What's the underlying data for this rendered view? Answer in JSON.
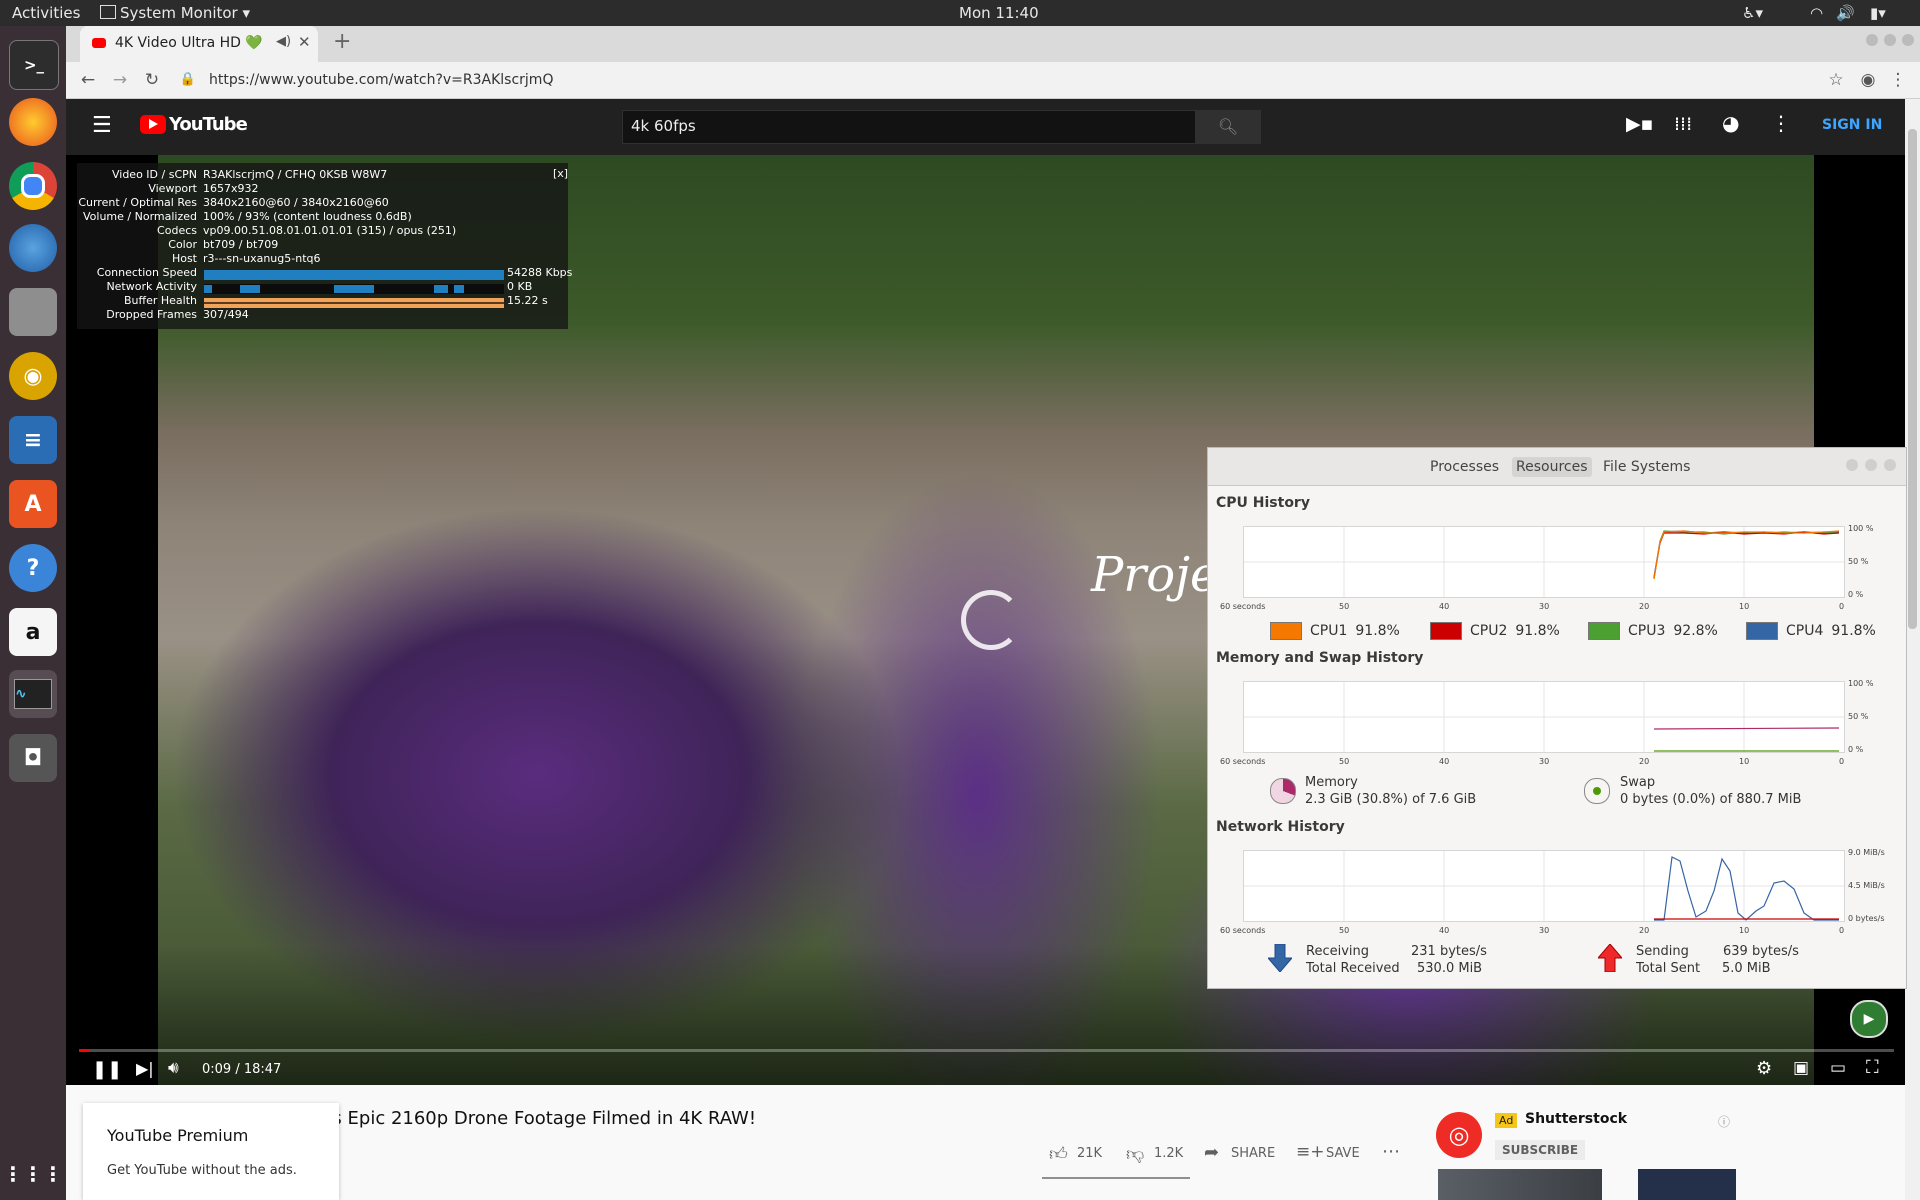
{
  "topbar": {
    "activities": "Activities",
    "app_menu": "System Monitor",
    "clock": "Mon 11:40"
  },
  "dock": {
    "items": [
      "terminal-icon",
      "firefox-icon",
      "chrome-icon",
      "thunderbird-icon",
      "files-icon",
      "rhythmbox-icon",
      "writer-icon",
      "software-icon",
      "help-icon",
      "amazon-icon",
      "system-monitor-icon",
      "screenshot-icon",
      "show-apps-icon"
    ]
  },
  "browser": {
    "tab_title": "4K Video Ultra HD 💚",
    "new_tab": "+",
    "url": "https://www.youtube.com/watch?v=R3AKlscrjmQ"
  },
  "youtube": {
    "logo_text": "YouTube",
    "search_value": "4k 60fps",
    "sign_in": "SIGN IN",
    "video_overlay_text": "Projec",
    "time": "0:09 / 18:47",
    "title": "ps Epic 2160p Drone Footage Filmed in 4K RAW!",
    "likes": "21K",
    "dislikes": "1.2K",
    "share": "SHARE",
    "save": "SAVE",
    "premium_title": "YouTube Premium",
    "premium_sub": "Get YouTube without the ads.",
    "ad_badge": "Ad",
    "ad_channel": "Shutterstock",
    "ad_subscribe": "SUBSCRIBE",
    "accent": "#ff0000",
    "signin_color": "#3ea6ff"
  },
  "stats": {
    "close": "[x]",
    "rows": [
      {
        "label": "Video ID / sCPN",
        "value": "R3AKlscrjmQ / CFHQ 0KSB W8W7"
      },
      {
        "label": "Viewport",
        "value": "1657x932"
      },
      {
        "label": "Current / Optimal Res",
        "value": "3840x2160@60 / 3840x2160@60"
      },
      {
        "label": "Volume / Normalized",
        "value": "100% / 93% (content loudness 0.6dB)"
      },
      {
        "label": "Codecs",
        "value": "vp09.00.51.08.01.01.01.01 (315) / opus (251)"
      },
      {
        "label": "Color",
        "value": "bt709 / bt709"
      },
      {
        "label": "Host",
        "value": "r3---sn-uxanug5-ntq6"
      },
      {
        "label": "Connection Speed",
        "value": "54288 Kbps"
      },
      {
        "label": "Network Activity",
        "value": "0 KB"
      },
      {
        "label": "Buffer Health",
        "value": "15.22 s"
      },
      {
        "label": "Dropped Frames",
        "value": "307/494"
      }
    ]
  },
  "sysmon": {
    "tabs": [
      "Processes",
      "Resources",
      "File Systems"
    ],
    "cpu_title": "CPU History",
    "mem_title": "Memory and Swap History",
    "net_title": "Network History",
    "x_ticks": [
      "60 seconds",
      "50",
      "40",
      "30",
      "20",
      "10",
      "0"
    ],
    "pct_ticks": [
      "100 %",
      "50 %",
      "0 %"
    ],
    "net_ticks": [
      "9.0 MiB/s",
      "4.5 MiB/s",
      "0 bytes/s"
    ],
    "cpus": [
      {
        "label": "CPU1",
        "value": "91.8%",
        "color": "#f57900"
      },
      {
        "label": "CPU2",
        "value": "91.8%",
        "color": "#cc0000"
      },
      {
        "label": "CPU3",
        "value": "92.8%",
        "color": "#4ca032"
      },
      {
        "label": "CPU4",
        "value": "91.8%",
        "color": "#3465a4"
      }
    ],
    "memory_label": "Memory",
    "memory_value": "2.3 GiB (30.8%) of 7.6 GiB",
    "swap_label": "Swap",
    "swap_value": "0 bytes (0.0%) of 880.7 MiB",
    "receiving_label": "Receiving",
    "receiving_value": "231 bytes/s",
    "total_received_label": "Total Received",
    "total_received_value": "530.0 MiB",
    "sending_label": "Sending",
    "sending_value": "639 bytes/s",
    "total_sent_label": "Total Sent",
    "total_sent_value": "5.0 MiB"
  }
}
